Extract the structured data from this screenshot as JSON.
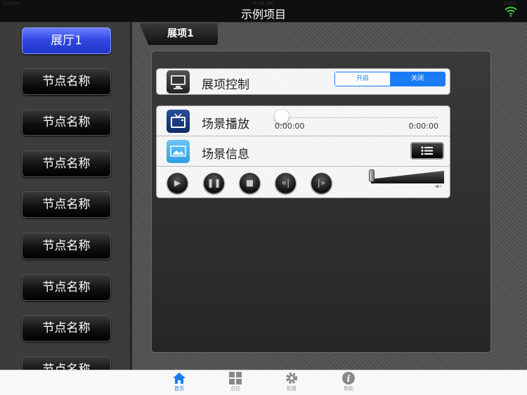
{
  "status": {
    "carrier": "Carrier",
    "time": "4:16 AM",
    "battery": "100%"
  },
  "header": {
    "title": "示例项目"
  },
  "sidebar": {
    "items": [
      {
        "label": "展厅1",
        "active": true
      },
      {
        "label": "节点名称"
      },
      {
        "label": "节点名称"
      },
      {
        "label": "节点名称"
      },
      {
        "label": "节点名称"
      },
      {
        "label": "节点名称"
      },
      {
        "label": "节点名称"
      },
      {
        "label": "节点名称"
      },
      {
        "label": "节点名称"
      }
    ]
  },
  "main": {
    "tab": "展项1",
    "control": {
      "label": "展项控制",
      "on": "开启",
      "off": "关闭",
      "selected": "关闭"
    },
    "scene_play": {
      "label": "场景播放",
      "current": "0:00:00",
      "total": "0:00:00",
      "progress": 0
    },
    "scene_info": {
      "label": "场景信息"
    },
    "volume": 0
  },
  "tabbar": {
    "items": [
      {
        "label": "首页",
        "icon": "home-icon"
      },
      {
        "label": "总控",
        "icon": "grid-icon"
      },
      {
        "label": "配置",
        "icon": "gear-icon"
      },
      {
        "label": "帮助",
        "icon": "info-icon"
      }
    ]
  },
  "colors": {
    "accent": "#1a7cf5",
    "active_sidebar": "#2e45e0",
    "wifi": "#3ec93e"
  }
}
